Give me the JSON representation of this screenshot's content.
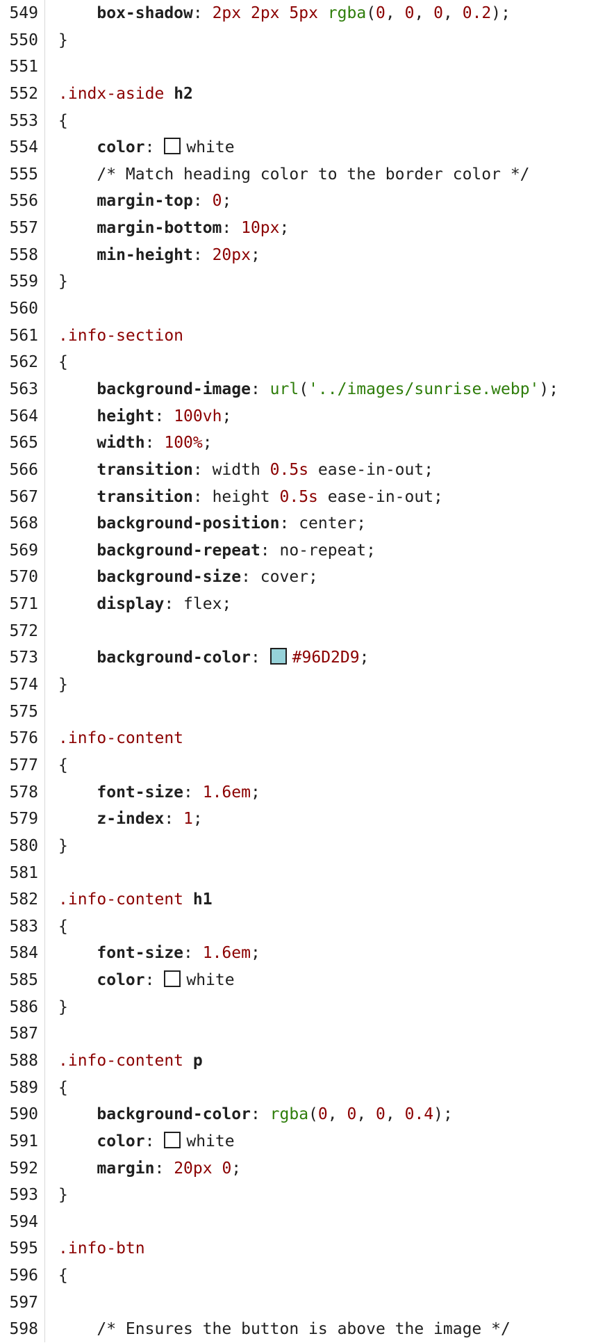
{
  "lines": [
    {
      "n": "549",
      "tokens": [
        {
          "t": "    "
        },
        {
          "t": "box-shadow",
          "c": "prop"
        },
        {
          "t": ": "
        },
        {
          "t": "2px",
          "c": "num"
        },
        {
          "t": " "
        },
        {
          "t": "2px",
          "c": "num"
        },
        {
          "t": " "
        },
        {
          "t": "5px",
          "c": "num"
        },
        {
          "t": " "
        },
        {
          "t": "rgba",
          "c": "fn"
        },
        {
          "t": "("
        },
        {
          "t": "0",
          "c": "num"
        },
        {
          "t": ", "
        },
        {
          "t": "0",
          "c": "num"
        },
        {
          "t": ", "
        },
        {
          "t": "0",
          "c": "num"
        },
        {
          "t": ", "
        },
        {
          "t": "0.2",
          "c": "num"
        },
        {
          "t": ");"
        }
      ]
    },
    {
      "n": "550",
      "tokens": [
        {
          "t": "}"
        }
      ]
    },
    {
      "n": "551",
      "tokens": []
    },
    {
      "n": "552",
      "tokens": [
        {
          "t": ".indx-aside",
          "c": "selector"
        },
        {
          "t": " "
        },
        {
          "t": "h2",
          "c": "prop"
        }
      ]
    },
    {
      "n": "553",
      "tokens": [
        {
          "t": "{"
        }
      ]
    },
    {
      "n": "554",
      "tokens": [
        {
          "t": "    "
        },
        {
          "t": "color",
          "c": "prop"
        },
        {
          "t": ": "
        },
        {
          "swatch": "#ffffff"
        },
        {
          "t": "white"
        }
      ]
    },
    {
      "n": "555",
      "tokens": [
        {
          "t": "    "
        },
        {
          "t": "/* Match heading color to the border color */",
          "c": "comment"
        }
      ]
    },
    {
      "n": "556",
      "tokens": [
        {
          "t": "    "
        },
        {
          "t": "margin-top",
          "c": "prop"
        },
        {
          "t": ": "
        },
        {
          "t": "0",
          "c": "num"
        },
        {
          "t": ";"
        }
      ]
    },
    {
      "n": "557",
      "tokens": [
        {
          "t": "    "
        },
        {
          "t": "margin-bottom",
          "c": "prop"
        },
        {
          "t": ": "
        },
        {
          "t": "10px",
          "c": "num"
        },
        {
          "t": ";"
        }
      ]
    },
    {
      "n": "558",
      "tokens": [
        {
          "t": "    "
        },
        {
          "t": "min-height",
          "c": "prop"
        },
        {
          "t": ": "
        },
        {
          "t": "20px",
          "c": "num"
        },
        {
          "t": ";"
        }
      ]
    },
    {
      "n": "559",
      "tokens": [
        {
          "t": "}"
        }
      ]
    },
    {
      "n": "560",
      "tokens": []
    },
    {
      "n": "561",
      "tokens": [
        {
          "t": ".info-section",
          "c": "selector"
        }
      ]
    },
    {
      "n": "562",
      "tokens": [
        {
          "t": "{"
        }
      ]
    },
    {
      "n": "563",
      "tokens": [
        {
          "t": "    "
        },
        {
          "t": "background-image",
          "c": "prop"
        },
        {
          "t": ": "
        },
        {
          "t": "url",
          "c": "fn"
        },
        {
          "t": "("
        },
        {
          "t": "'../images/sunrise.webp'",
          "c": "str"
        },
        {
          "t": ");"
        }
      ]
    },
    {
      "n": "564",
      "tokens": [
        {
          "t": "    "
        },
        {
          "t": "height",
          "c": "prop"
        },
        {
          "t": ": "
        },
        {
          "t": "100vh",
          "c": "num"
        },
        {
          "t": ";"
        }
      ]
    },
    {
      "n": "565",
      "tokens": [
        {
          "t": "    "
        },
        {
          "t": "width",
          "c": "prop"
        },
        {
          "t": ": "
        },
        {
          "t": "100%",
          "c": "num"
        },
        {
          "t": ";"
        }
      ]
    },
    {
      "n": "566",
      "tokens": [
        {
          "t": "    "
        },
        {
          "t": "transition",
          "c": "prop"
        },
        {
          "t": ": width "
        },
        {
          "t": "0.5s",
          "c": "num"
        },
        {
          "t": " ease-in-out;"
        }
      ]
    },
    {
      "n": "567",
      "tokens": [
        {
          "t": "    "
        },
        {
          "t": "transition",
          "c": "prop"
        },
        {
          "t": ": height "
        },
        {
          "t": "0.5s",
          "c": "num"
        },
        {
          "t": " ease-in-out;"
        }
      ]
    },
    {
      "n": "568",
      "tokens": [
        {
          "t": "    "
        },
        {
          "t": "background-position",
          "c": "prop"
        },
        {
          "t": ": center;"
        }
      ]
    },
    {
      "n": "569",
      "tokens": [
        {
          "t": "    "
        },
        {
          "t": "background-repeat",
          "c": "prop"
        },
        {
          "t": ": no-repeat;"
        }
      ]
    },
    {
      "n": "570",
      "tokens": [
        {
          "t": "    "
        },
        {
          "t": "background-size",
          "c": "prop"
        },
        {
          "t": ": cover;"
        }
      ]
    },
    {
      "n": "571",
      "tokens": [
        {
          "t": "    "
        },
        {
          "t": "display",
          "c": "prop"
        },
        {
          "t": ": flex;"
        }
      ]
    },
    {
      "n": "572",
      "tokens": []
    },
    {
      "n": "573",
      "tokens": [
        {
          "t": "    "
        },
        {
          "t": "background-color",
          "c": "prop"
        },
        {
          "t": ": "
        },
        {
          "swatch": "#96D2D9"
        },
        {
          "t": "#96D2D9",
          "c": "hexcol"
        },
        {
          "t": ";"
        }
      ]
    },
    {
      "n": "574",
      "tokens": [
        {
          "t": "}"
        }
      ]
    },
    {
      "n": "575",
      "tokens": []
    },
    {
      "n": "576",
      "tokens": [
        {
          "t": ".info-content",
          "c": "selector"
        }
      ]
    },
    {
      "n": "577",
      "tokens": [
        {
          "t": "{"
        }
      ]
    },
    {
      "n": "578",
      "tokens": [
        {
          "t": "    "
        },
        {
          "t": "font-size",
          "c": "prop"
        },
        {
          "t": ": "
        },
        {
          "t": "1.6em",
          "c": "num"
        },
        {
          "t": ";"
        }
      ]
    },
    {
      "n": "579",
      "tokens": [
        {
          "t": "    "
        },
        {
          "t": "z-index",
          "c": "prop"
        },
        {
          "t": ": "
        },
        {
          "t": "1",
          "c": "num"
        },
        {
          "t": ";"
        }
      ]
    },
    {
      "n": "580",
      "tokens": [
        {
          "t": "}"
        }
      ]
    },
    {
      "n": "581",
      "tokens": []
    },
    {
      "n": "582",
      "tokens": [
        {
          "t": ".info-content",
          "c": "selector"
        },
        {
          "t": " "
        },
        {
          "t": "h1",
          "c": "prop"
        }
      ]
    },
    {
      "n": "583",
      "tokens": [
        {
          "t": "{"
        }
      ]
    },
    {
      "n": "584",
      "tokens": [
        {
          "t": "    "
        },
        {
          "t": "font-size",
          "c": "prop"
        },
        {
          "t": ": "
        },
        {
          "t": "1.6em",
          "c": "num"
        },
        {
          "t": ";"
        }
      ]
    },
    {
      "n": "585",
      "tokens": [
        {
          "t": "    "
        },
        {
          "t": "color",
          "c": "prop"
        },
        {
          "t": ": "
        },
        {
          "swatch": "#ffffff"
        },
        {
          "t": "white"
        }
      ]
    },
    {
      "n": "586",
      "tokens": [
        {
          "t": "}"
        }
      ]
    },
    {
      "n": "587",
      "tokens": []
    },
    {
      "n": "588",
      "tokens": [
        {
          "t": ".info-content",
          "c": "selector"
        },
        {
          "t": " "
        },
        {
          "t": "p",
          "c": "prop"
        }
      ]
    },
    {
      "n": "589",
      "tokens": [
        {
          "t": "{"
        }
      ]
    },
    {
      "n": "590",
      "tokens": [
        {
          "t": "    "
        },
        {
          "t": "background-color",
          "c": "prop"
        },
        {
          "t": ": "
        },
        {
          "t": "rgba",
          "c": "fn"
        },
        {
          "t": "("
        },
        {
          "t": "0",
          "c": "num"
        },
        {
          "t": ", "
        },
        {
          "t": "0",
          "c": "num"
        },
        {
          "t": ", "
        },
        {
          "t": "0",
          "c": "num"
        },
        {
          "t": ", "
        },
        {
          "t": "0.4",
          "c": "num"
        },
        {
          "t": ");"
        }
      ]
    },
    {
      "n": "591",
      "tokens": [
        {
          "t": "    "
        },
        {
          "t": "color",
          "c": "prop"
        },
        {
          "t": ": "
        },
        {
          "swatch": "#ffffff"
        },
        {
          "t": "white"
        }
      ]
    },
    {
      "n": "592",
      "tokens": [
        {
          "t": "    "
        },
        {
          "t": "margin",
          "c": "prop"
        },
        {
          "t": ": "
        },
        {
          "t": "20px",
          "c": "num"
        },
        {
          "t": " "
        },
        {
          "t": "0",
          "c": "num"
        },
        {
          "t": ";"
        }
      ]
    },
    {
      "n": "593",
      "tokens": [
        {
          "t": "}"
        }
      ]
    },
    {
      "n": "594",
      "tokens": []
    },
    {
      "n": "595",
      "tokens": [
        {
          "t": ".info-btn",
          "c": "selector"
        }
      ]
    },
    {
      "n": "596",
      "tokens": [
        {
          "t": "{"
        }
      ]
    },
    {
      "n": "597",
      "tokens": []
    },
    {
      "n": "598",
      "tokens": [
        {
          "t": "    "
        },
        {
          "t": "/* Ensures the button is above the image */",
          "c": "comment"
        }
      ]
    }
  ]
}
